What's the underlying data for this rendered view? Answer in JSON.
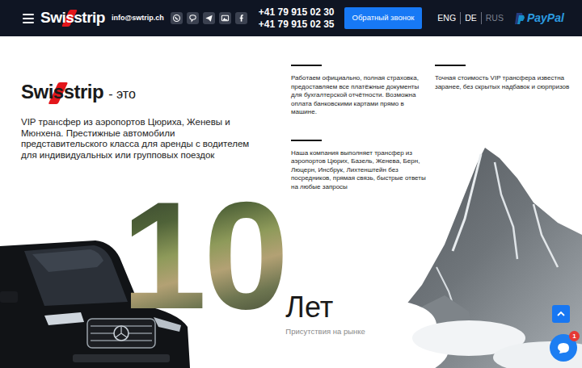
{
  "header": {
    "logo": "Swisstrip",
    "email": "info@swtrip.ch",
    "phones": [
      "+41 79 915 02 30",
      "+41 79 915 02 35"
    ],
    "callback_button": "Обратный звонок",
    "languages": [
      {
        "label": "ENG",
        "selected": false
      },
      {
        "label": "DE",
        "selected": false
      },
      {
        "label": "RUS",
        "selected": true
      }
    ],
    "payment_logo": "PayPal"
  },
  "intro": {
    "brand": "Swisstrip",
    "suffix": "- это",
    "description": "VIP трансфер из аэропортов Цюриха, Женевы и Мюнхена. Престижные автомобили представительского класса для аренды с водителем для индивидуальных или групповых поездок"
  },
  "features": [
    "Работаем официально, полная страховка, предоставляем все платёжные документы для бухгалтерской отчётности. Возможна оплата банковскими картами прямо в машине.",
    "Точная стоимость VIP трансфера известна заранее, без скрытых надбавок и сюрпризов",
    "Наша компания выполняет трансфер из аэропортов Цюрих, Базель, Женева, Берн, Люцерн, Инсбрук, Лихтенштейн без посредников, прямая связь, быстрые ответы на любые запросы"
  ],
  "years": {
    "number": "10",
    "unit": "Лет",
    "caption": "Присутствия на рынке"
  },
  "chat": {
    "badge": "1"
  }
}
